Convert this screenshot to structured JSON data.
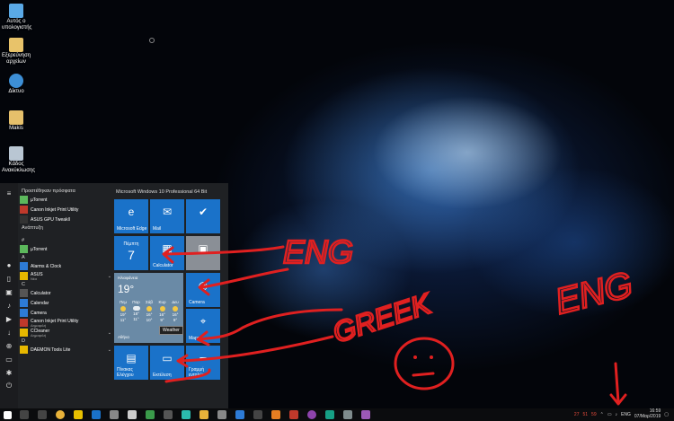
{
  "desktop_icons": [
    {
      "label": "Αυτός ο υπολογιστής",
      "icon": "computer-icon",
      "color": "#5aa9e6"
    },
    {
      "label": "Εξερεύνηση αρχείων",
      "icon": "explorer-icon",
      "color": "#e8c36a"
    },
    {
      "label": "Δίκτυο",
      "icon": "network-icon",
      "color": "#3d8fd6"
    },
    {
      "label": "Makis",
      "icon": "user-folder-icon",
      "color": "#e6c06b"
    },
    {
      "label": "Κάδος Ανακύκλωσης",
      "icon": "recycle-bin-icon",
      "color": "#b9c6d3"
    }
  ],
  "start_menu": {
    "sections": {
      "recent": "Προστέθηκαν πρόσφατα",
      "expand": "Ανάπτυξη",
      "hash": "#",
      "a": "A",
      "c": "C",
      "d": "D"
    },
    "recent_apps": [
      {
        "label": "µTorrent"
      },
      {
        "label": "Canon Inkjet Print Utility"
      },
      {
        "label": "ASUS GPU Tweakll"
      }
    ],
    "apps": {
      "hash": [
        {
          "label": "µTorrent"
        }
      ],
      "a": [
        {
          "label": "Alarms & Clock",
          "sub": ""
        },
        {
          "label": "ASUS",
          "sub": "Νέα",
          "chevron": "⌄"
        }
      ],
      "c": [
        {
          "label": "Calculator",
          "sub": ""
        },
        {
          "label": "Calendar",
          "sub": ""
        },
        {
          "label": "Camera",
          "sub": ""
        },
        {
          "label": "Canon Inkjet Print Utility",
          "sub": "Δημοφιλή"
        },
        {
          "label": "CCleaner",
          "sub": "Δημοφιλή",
          "chevron": "⌄"
        }
      ],
      "d": [
        {
          "label": "DAEMON Tools Lite",
          "sub": "",
          "chevron": "⌄"
        }
      ]
    },
    "tiles_title": "Microsoft Windows 10 Professional 64 Bit",
    "tiles": {
      "edge": {
        "label": "Microsoft Edge",
        "icon": "edge-icon"
      },
      "mail": {
        "label": "Mail",
        "icon": "mail-icon"
      },
      "todo": {
        "label": "",
        "icon": "checkmark-icon"
      },
      "calendar": {
        "day": "Πέμπτη",
        "date": "7",
        "label": ""
      },
      "calculator": {
        "label": "Calculator",
        "icon": "calculator-icon"
      },
      "photo": {
        "label": "",
        "icon": "photo-icon"
      },
      "camera": {
        "label": "Camera",
        "icon": "camera-icon"
      },
      "maps": {
        "label": "Maps",
        "icon": "maps-icon"
      },
      "store": {
        "label": "Πίνακας Ελέγχου",
        "icon": "control-panel-icon"
      },
      "settings": {
        "label": "Εκτέλεση",
        "icon": "run-icon"
      },
      "cmd": {
        "label": "Γραμμή εντολών",
        "icon": "cmd-icon"
      }
    },
    "weather": {
      "title": "Ηλιοφάνεια",
      "temp": "19°",
      "place": "Αθήνα",
      "days": [
        {
          "day": "Πεμ",
          "hi": "19°",
          "lo": "11°",
          "icon": "sun"
        },
        {
          "day": "Παρ",
          "hi": "18°",
          "lo": "11°",
          "icon": "cloud"
        },
        {
          "day": "Σάβ",
          "hi": "16°",
          "lo": "10°",
          "icon": "sun"
        },
        {
          "day": "Κυρ",
          "hi": "16°",
          "lo": "9°",
          "icon": "sun"
        },
        {
          "day": "Δευ",
          "hi": "16°",
          "lo": "9°",
          "icon": "sun"
        }
      ],
      "tooltip": "Weather"
    }
  },
  "annotations": {
    "eng_left": "ENG",
    "greek": "GREEK",
    "eng_right": "ENG",
    "color": "#e02020"
  },
  "taskbar": {
    "tray_numbers": [
      "27",
      "51",
      "59"
    ],
    "language": "ENG",
    "time": "16:59",
    "date": "07/Μαρ/2019",
    "colors": {
      "accent": "#1a72c9",
      "taskbar": "#0b0c0e",
      "start_bg": "#1f2124"
    }
  }
}
